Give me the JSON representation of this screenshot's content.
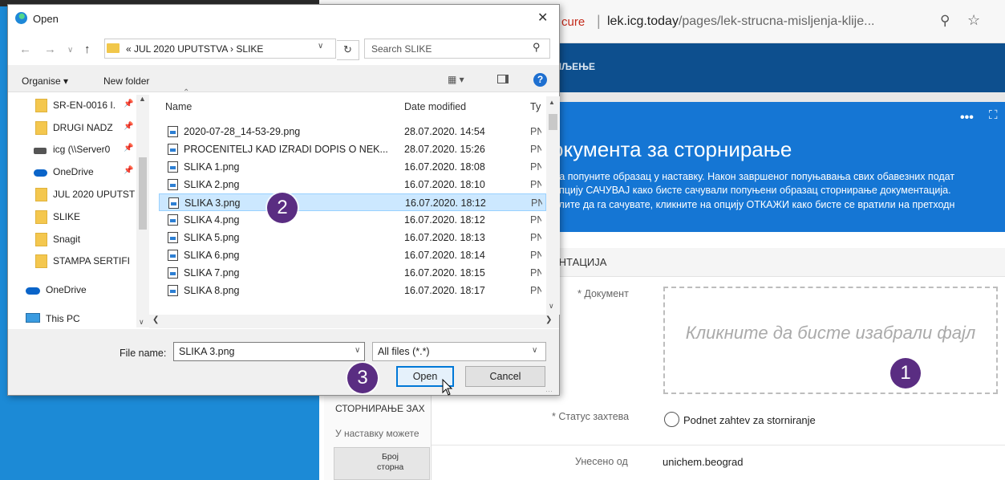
{
  "browser": {
    "secure_text": "cure",
    "url_host": "lek.icg.today",
    "url_path": "/pages/lek-strucna-misljenja-klije...",
    "zoom_icon": "zoom-out-icon",
    "star_icon": "favorite-star-icon"
  },
  "page": {
    "nav_label": "ШЉЕЊЕ",
    "panel_title": "окумента за сторнирање",
    "panel_lines": [
      "да попуните образац у наставку. Након завршеног попуњавања свих обавезних подат",
      "опцију САЧУВАЈ како бисте сачували попуњени образац сторнирање документација.",
      "елите да га сачувате, кликните на опцију ОТКАЖИ како бисте се вратили на претходн"
    ],
    "section_title": "ЕНТАЦИЈА",
    "doc_label": "* Документ",
    "dropzone_text": "Кликните да бисте изабрали фајл",
    "status_label": "* Статус захтева",
    "status_option": "Podnet zahtev za storniranje",
    "entered_label": "Унесено од",
    "entered_value": "unichem.beograd",
    "card_title": "СТОРНИРАЊЕ ЗАХ",
    "card_text": "У наставку можете",
    "card_col1": "Број",
    "card_col2": "сторна"
  },
  "dialog": {
    "title": "Open",
    "address_path": "«  JUL 2020 UPUTSTVA  ›  SLIKE",
    "search_placeholder": "Search SLIKE",
    "organise": "Organise ▾",
    "new_folder": "New folder",
    "tree": [
      {
        "label": "SR-EN-0016 I.",
        "icon": "folder",
        "pinned": true
      },
      {
        "label": "DRUGI NADZ",
        "icon": "folder",
        "pinned": true
      },
      {
        "label": "icg (\\\\Server0",
        "icon": "network-drive",
        "pinned": true
      },
      {
        "label": "OneDrive",
        "icon": "cloud",
        "pinned": true
      },
      {
        "label": "JUL 2020 UPUTST",
        "icon": "folder",
        "pinned": false
      },
      {
        "label": "SLIKE",
        "icon": "folder",
        "pinned": false
      },
      {
        "label": "Snagit",
        "icon": "folder",
        "pinned": false
      },
      {
        "label": "STAMPA SERTIFI",
        "icon": "folder",
        "pinned": false
      },
      {
        "label": "OneDrive",
        "icon": "cloud",
        "pinned": false
      },
      {
        "label": "This PC",
        "icon": "computer",
        "pinned": false
      }
    ],
    "columns": {
      "name": "Name",
      "date": "Date modified",
      "type": "Ty"
    },
    "files": [
      {
        "name": "2020-07-28_14-53-29.png",
        "date": "28.07.2020. 14:54",
        "type": "PN"
      },
      {
        "name": "PROCENITELJ KAD IZRADI DOPIS O NEK...",
        "date": "28.07.2020. 15:26",
        "type": "PN"
      },
      {
        "name": "SLIKA 1.png",
        "date": "16.07.2020. 18:08",
        "type": "PN"
      },
      {
        "name": "SLIKA 2.png",
        "date": "16.07.2020. 18:10",
        "type": "PN"
      },
      {
        "name": "SLIKA 3.png",
        "date": "16.07.2020. 18:12",
        "type": "PN",
        "selected": true
      },
      {
        "name": "SLIKA 4.png",
        "date": "16.07.2020. 18:12",
        "type": "PN"
      },
      {
        "name": "SLIKA 5.png",
        "date": "16.07.2020. 18:13",
        "type": "PN"
      },
      {
        "name": "SLIKA 6.png",
        "date": "16.07.2020. 18:14",
        "type": "PN"
      },
      {
        "name": "SLIKA 7.png",
        "date": "16.07.2020. 18:15",
        "type": "PN"
      },
      {
        "name": "SLIKA 8.png",
        "date": "16.07.2020. 18:17",
        "type": "PN"
      }
    ],
    "file_name_label": "File name:",
    "file_name_value": "SLIKA 3.png",
    "filter_value": "All files (*.*)",
    "open_label": "Open",
    "cancel_label": "Cancel"
  },
  "markers": [
    "1",
    "2",
    "3"
  ],
  "colors": {
    "marker": "#5a2d82",
    "accent": "#0078d7",
    "panel": "#1576d4",
    "selection": "#cce8ff"
  }
}
